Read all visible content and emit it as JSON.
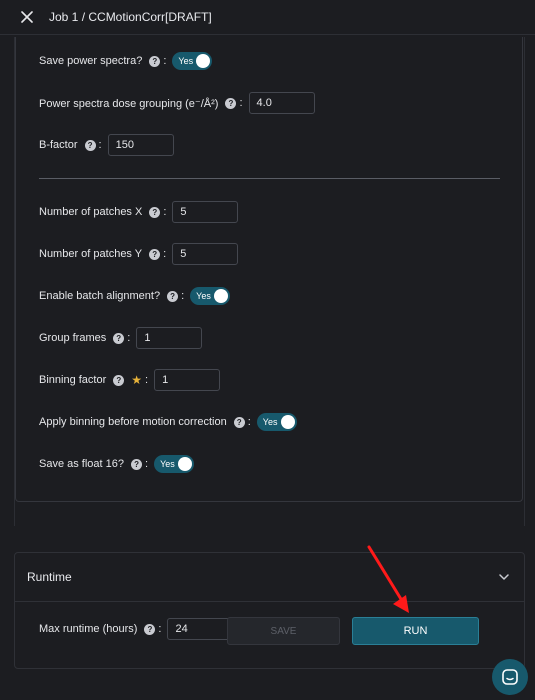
{
  "header": {
    "title": "Job 1 / CCMotionCorr[DRAFT]"
  },
  "params": {
    "save_power_spectra": {
      "label": "Save power spectra?",
      "toggle": "Yes"
    },
    "power_spectra_grouping": {
      "label": "Power spectra dose grouping (e⁻/Å²)",
      "value": "4.0"
    },
    "bfactor": {
      "label": "B-factor",
      "value": "150"
    },
    "patches_x": {
      "label": "Number of patches X",
      "value": "5"
    },
    "patches_y": {
      "label": "Number of patches Y",
      "value": "5"
    },
    "batch_alignment": {
      "label": "Enable batch alignment?",
      "toggle": "Yes"
    },
    "group_frames": {
      "label": "Group frames",
      "value": "1"
    },
    "binning_factor": {
      "label": "Binning factor",
      "value": "1"
    },
    "apply_binning": {
      "label": "Apply binning before motion correction",
      "toggle": "Yes"
    },
    "float16": {
      "label": "Save as float 16?",
      "toggle": "Yes"
    }
  },
  "runtime": {
    "title": "Runtime",
    "max_runtime": {
      "label": "Max runtime (hours)",
      "value": "24"
    }
  },
  "buttons": {
    "save": "SAVE",
    "run": "RUN"
  },
  "glyphs": {
    "help": "?",
    "colon": ":",
    "star": "★"
  },
  "colors": {
    "accent": "#17596c",
    "annotation_arrow": "#ff1a1a",
    "background": "#1c1d21"
  }
}
